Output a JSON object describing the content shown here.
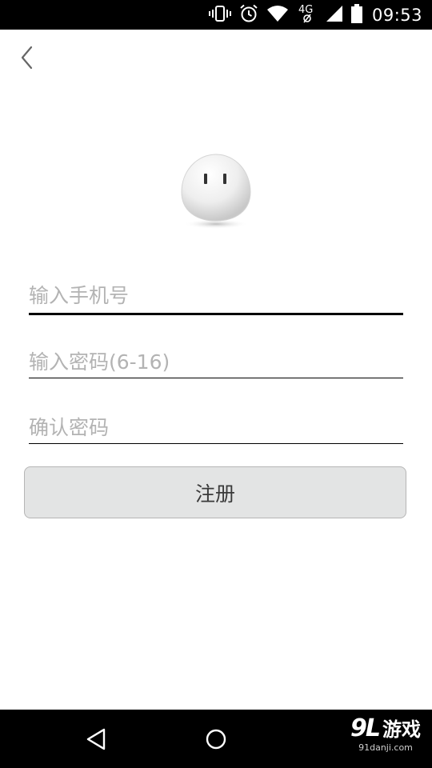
{
  "status_bar": {
    "time": "09:53",
    "network_label": "4G",
    "icons": [
      "vibrate-icon",
      "alarm-icon",
      "wifi-icon",
      "signal-icon",
      "battery-icon"
    ]
  },
  "header": {
    "back_icon": "chevron-left-icon"
  },
  "form": {
    "phone": {
      "placeholder": "输入手机号",
      "value": ""
    },
    "password": {
      "placeholder": "输入密码(6-16)",
      "value": ""
    },
    "confirm_password": {
      "placeholder": "确认密码",
      "value": ""
    },
    "register_label": "注册"
  },
  "nav_bar": {
    "icons": [
      "back-triangle-icon",
      "home-circle-icon"
    ]
  },
  "watermark": {
    "logo_number": "9L",
    "logo_text": "游戏",
    "url": "91danji.com"
  },
  "colors": {
    "status_bar": "#000000",
    "background": "#ffffff",
    "button_bg": "#e3e4e4",
    "button_border": "#b5b5b5",
    "placeholder": "#b3b3b3",
    "underline": "#000000"
  }
}
